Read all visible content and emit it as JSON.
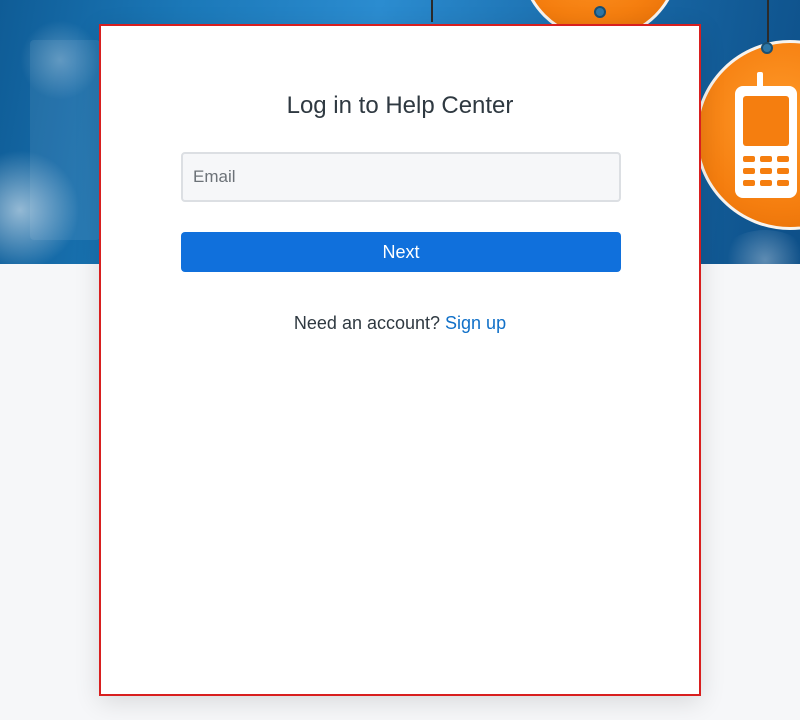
{
  "login": {
    "title": "Log in to Help Center",
    "email_placeholder": "Email",
    "email_value": "",
    "next_label": "Next",
    "signup_prompt": "Need an account?",
    "signup_link": "Sign up"
  },
  "colors": {
    "primary_button": "#1070dc",
    "link": "#1070c8",
    "card_border": "#d81f1f",
    "hero_blue": "#1b78b8",
    "tag_orange": "#f57e0f"
  },
  "icons": {
    "hero_decoration": "mobile-phone-icon"
  }
}
